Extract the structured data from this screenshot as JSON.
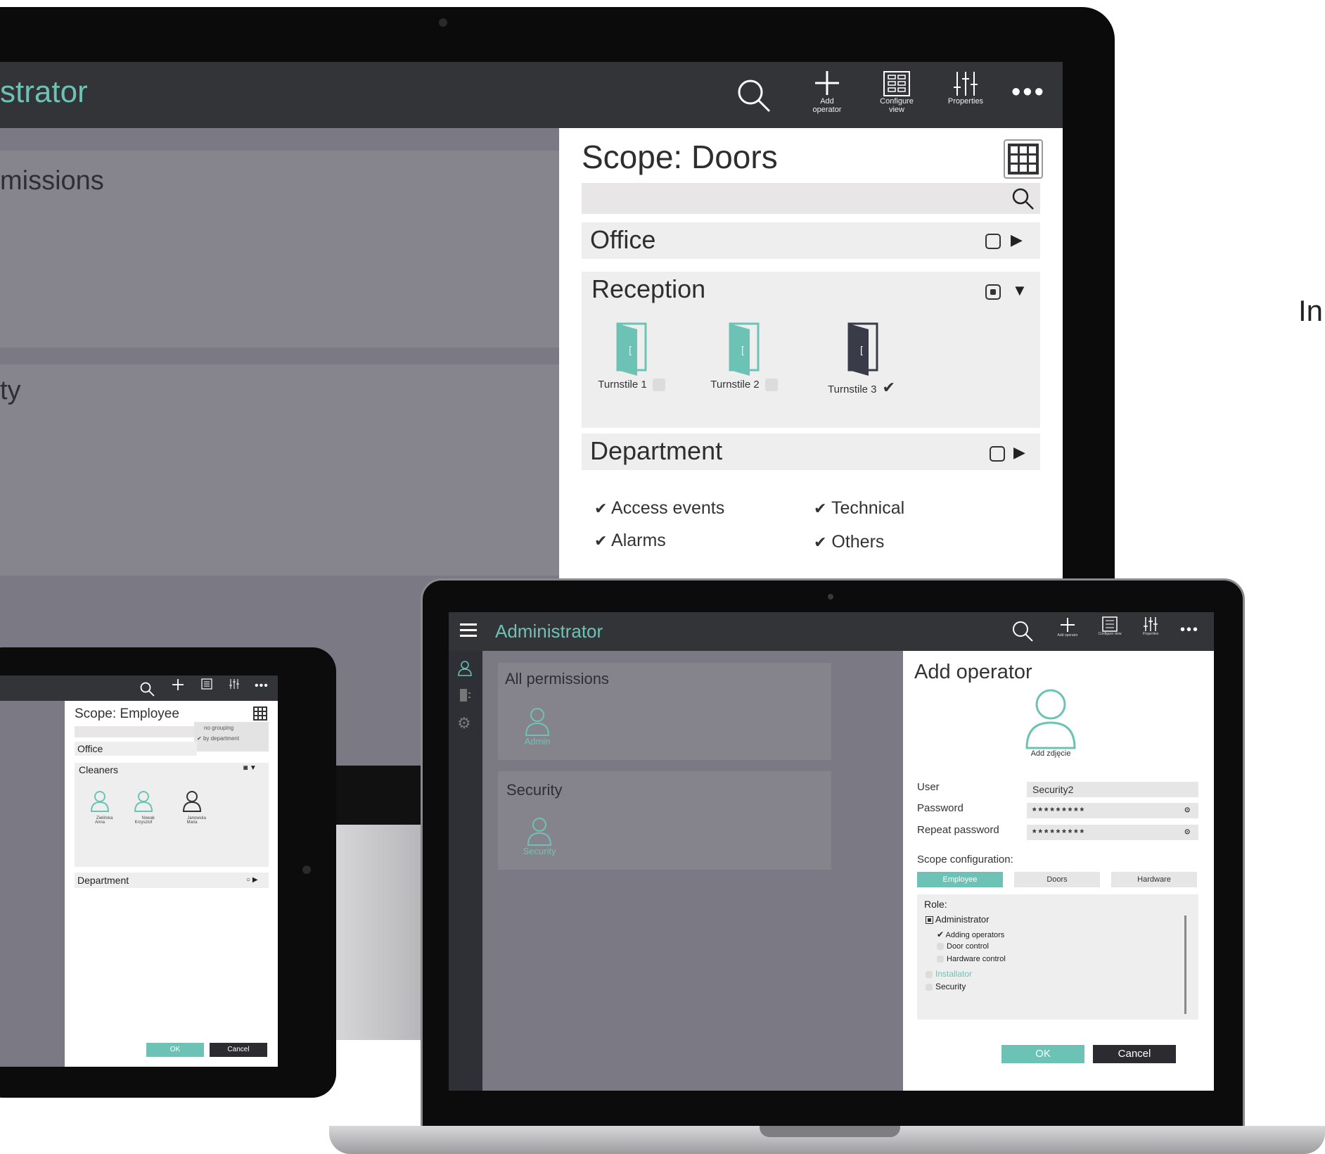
{
  "monitor": {
    "title_fragment": "strator",
    "toolbar": {
      "add_operator": "Add\noperator",
      "configure_view": "Configure\nview",
      "properties": "Properties"
    },
    "left": {
      "item1": "missions",
      "item2": "ty"
    },
    "panel": {
      "title": "Scope: Doors",
      "groups": [
        {
          "label": "Office"
        },
        {
          "label": "Reception"
        },
        {
          "label": "Department"
        }
      ],
      "doors": [
        {
          "label": "Turnstile 1",
          "checked": false,
          "color": "#6cc3b5"
        },
        {
          "label": "Turnstile 2",
          "checked": false,
          "color": "#6cc3b5"
        },
        {
          "label": "Turnstile 3",
          "checked": true,
          "color": "#3a3b48"
        }
      ],
      "events": [
        "Access events",
        "Technical",
        "Alarms",
        "Others"
      ]
    }
  },
  "side_text": "In",
  "tablet": {
    "panel_title": "Scope: Employee",
    "grouping_menu": [
      "no grouping",
      "by department"
    ],
    "groups": [
      "Office",
      "Cleaners",
      "Department"
    ],
    "people": [
      {
        "name": "Zielińska\nAnna"
      },
      {
        "name": "Nowak\nKrzysztof"
      },
      {
        "name": "Janowska\nMaria"
      }
    ],
    "ok": "OK",
    "cancel": "Cancel"
  },
  "laptop": {
    "title": "Administrator",
    "toolbar": {
      "add_operator": "Add operator",
      "configure_view": "Configure view",
      "properties": "Properties"
    },
    "left": {
      "group1": "All permissions",
      "user1": "Admin",
      "group2": "Security",
      "user2": "Security"
    },
    "form": {
      "title": "Add operator",
      "photo_label": "Add zdjęcie",
      "user_label": "User",
      "user_value": "Security2",
      "password_label": "Password",
      "password_value": "*********",
      "repeat_label": "Repeat password",
      "repeat_value": "*********",
      "scope_label": "Scope configuration:",
      "scope_tabs": [
        "Employee",
        "Doors",
        "Hardware"
      ],
      "role_label": "Role:",
      "roles": [
        {
          "label": "Administrator",
          "level": 0
        },
        {
          "label": "Adding operators",
          "level": 1
        },
        {
          "label": "Door control",
          "level": 1
        },
        {
          "label": "Hardware control",
          "level": 1
        },
        {
          "label": "Installator",
          "level": 0
        },
        {
          "label": "Security",
          "level": 0
        }
      ],
      "ok": "OK",
      "cancel": "Cancel"
    }
  },
  "colors": {
    "accent": "#6cc3b5",
    "bar": "#333438",
    "bg": "#7b7a84"
  }
}
